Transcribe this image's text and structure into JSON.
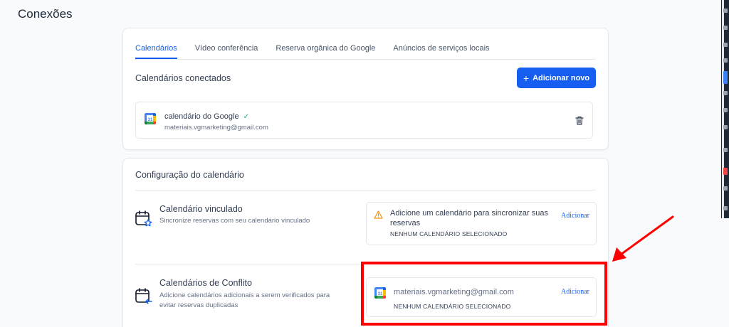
{
  "page": {
    "title": "Conexões"
  },
  "tabs": [
    {
      "label": "Calendários",
      "active": true
    },
    {
      "label": "Vídeo conferência",
      "active": false
    },
    {
      "label": "Reserva orgânica do Google",
      "active": false
    },
    {
      "label": "Anúncios de serviços locais",
      "active": false
    }
  ],
  "connected": {
    "title": "Calendários conectados",
    "add_button": "Adicionar novo",
    "item": {
      "name": "calendário do Google",
      "email": "materiais.vgmarketing@gmail.com",
      "icon": "google-calendar-icon"
    }
  },
  "config": {
    "title": "Configuração do calendário",
    "linked": {
      "title": "Calendário vinculado",
      "desc": "Sincronize reservas com seu calendário vinculado",
      "warning": "Adicione um calendário para sincronizar suas reservas",
      "none_selected": "NENHUM CALENDÁRIO SELECIONADO",
      "add_link": "Adicionar"
    },
    "conflict": {
      "title": "Calendários de Conflito",
      "desc": "Adicione calendários adicionais a serem verificados para evitar reservas duplicadas",
      "email": "materiais.vgmarketing@gmail.com",
      "none_selected": "NENHUM CALENDÁRIO SELECIONADO",
      "add_link": "Adicionar"
    }
  },
  "colors": {
    "primary": "#155eef",
    "success": "#12b76a",
    "warning": "#f79009",
    "annotation": "#ff0000"
  }
}
